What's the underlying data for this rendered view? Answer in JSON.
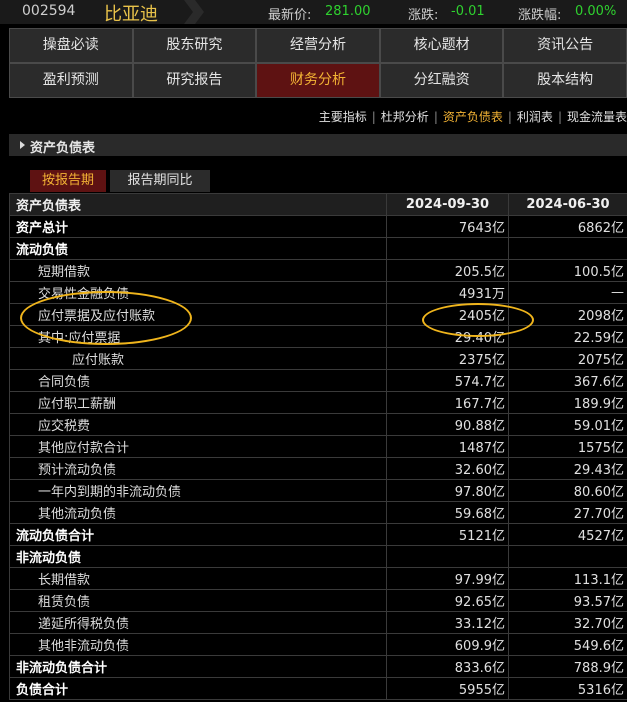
{
  "header": {
    "code": "002594",
    "name": "比亚迪",
    "price_label": "最新价:",
    "price": "281.00",
    "change_label": "涨跌:",
    "change": "-0.01",
    "pct_label": "涨跌幅:",
    "pct": "0.00%"
  },
  "nav_row1": [
    "操盘必读",
    "股东研究",
    "经营分析",
    "核心题材",
    "资讯公告"
  ],
  "nav_row2": [
    "盈利预测",
    "研究报告",
    "财务分析",
    "分红融资",
    "股本结构"
  ],
  "nav_active": "财务分析",
  "subnav": [
    "主要指标",
    "杜邦分析",
    "资产负债表",
    "利润表",
    "现金流量表"
  ],
  "subnav_active": "资产负债表",
  "section_title": "资产负债表",
  "tabs": [
    "按报告期",
    "报告期同比"
  ],
  "table": {
    "header": [
      "资产负债表",
      "2024-09-30",
      "2024-06-30"
    ],
    "rows": [
      {
        "label": "资产总计",
        "v1": "7643亿",
        "v2": "6862亿",
        "style": "bold"
      },
      {
        "label": "流动负债",
        "v1": "",
        "v2": "",
        "style": "bold"
      },
      {
        "label": "短期借款",
        "v1": "205.5亿",
        "v2": "100.5亿",
        "style": "l1"
      },
      {
        "label": "交易性金融负债",
        "v1": "4931万",
        "v2": "—",
        "style": "l1"
      },
      {
        "label": "应付票据及应付账款",
        "v1": "2405亿",
        "v2": "2098亿",
        "style": "l1"
      },
      {
        "label": "其中:应付票据",
        "v1": "29.40亿",
        "v2": "22.59亿",
        "style": "l1"
      },
      {
        "label": "应付账款",
        "v1": "2375亿",
        "v2": "2075亿",
        "style": "l2"
      },
      {
        "label": "合同负债",
        "v1": "574.7亿",
        "v2": "367.6亿",
        "style": "l1"
      },
      {
        "label": "应付职工薪酬",
        "v1": "167.7亿",
        "v2": "189.9亿",
        "style": "l1"
      },
      {
        "label": "应交税费",
        "v1": "90.88亿",
        "v2": "59.01亿",
        "style": "l1"
      },
      {
        "label": "其他应付款合计",
        "v1": "1487亿",
        "v2": "1575亿",
        "style": "l1"
      },
      {
        "label": "预计流动负债",
        "v1": "32.60亿",
        "v2": "29.43亿",
        "style": "l1"
      },
      {
        "label": "一年内到期的非流动负债",
        "v1": "97.80亿",
        "v2": "80.60亿",
        "style": "l1"
      },
      {
        "label": "其他流动负债",
        "v1": "59.68亿",
        "v2": "27.70亿",
        "style": "l1"
      },
      {
        "label": "流动负债合计",
        "v1": "5121亿",
        "v2": "4527亿",
        "style": "bold"
      },
      {
        "label": "非流动负债",
        "v1": "",
        "v2": "",
        "style": "bold"
      },
      {
        "label": "长期借款",
        "v1": "97.99亿",
        "v2": "113.1亿",
        "style": "l1"
      },
      {
        "label": "租赁负债",
        "v1": "92.65亿",
        "v2": "93.57亿",
        "style": "l1"
      },
      {
        "label": "递延所得税负债",
        "v1": "33.12亿",
        "v2": "32.70亿",
        "style": "l1"
      },
      {
        "label": "其他非流动负债",
        "v1": "609.9亿",
        "v2": "549.6亿",
        "style": "l1"
      },
      {
        "label": "非流动负债合计",
        "v1": "833.6亿",
        "v2": "788.9亿",
        "style": "bold"
      },
      {
        "label": "负债合计",
        "v1": "5955亿",
        "v2": "5316亿",
        "style": "bold"
      }
    ]
  },
  "colors": {
    "accent": "#f2b234",
    "active_bg": "#5e1212",
    "highlight": "#f0b51c",
    "down": "#2fd12f"
  }
}
